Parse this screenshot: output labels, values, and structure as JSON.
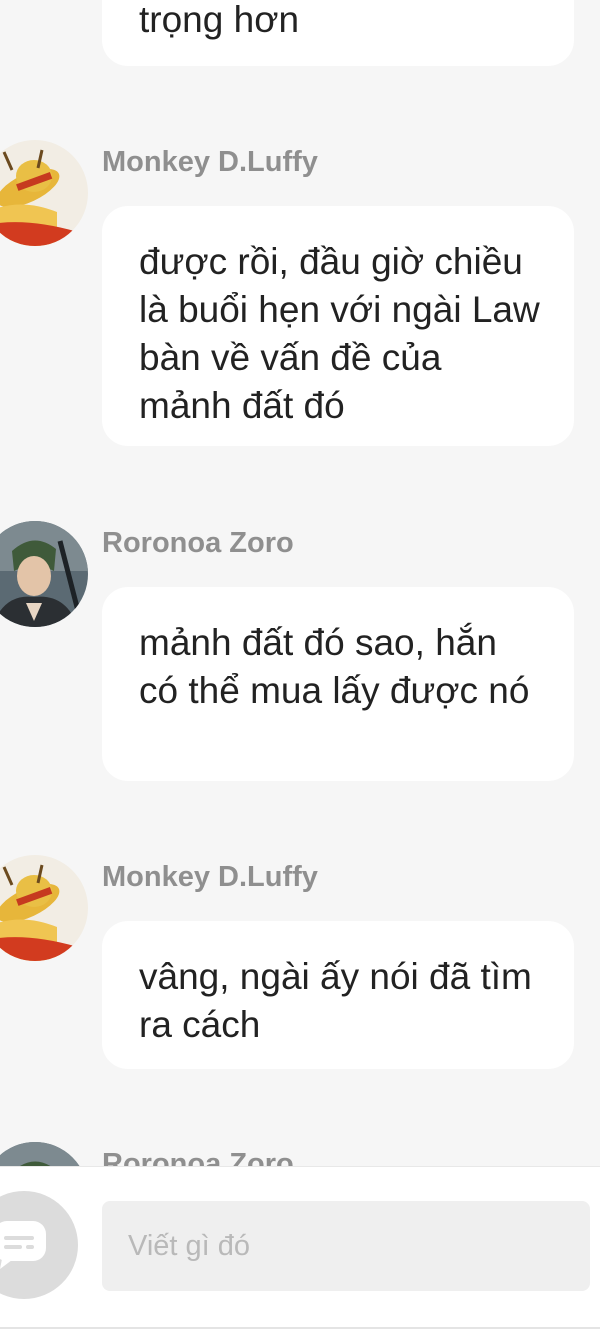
{
  "messages": [
    {
      "sender": "",
      "text": "trọng hơn"
    },
    {
      "sender": "Monkey D.Luffy",
      "text": "được rồi, đầu giờ chiều là buổi hẹn với ngài Law bàn về vấn đề của mảnh đất đó"
    },
    {
      "sender": "Roronoa Zoro",
      "text": "mảnh đất đó sao, hắn có thể mua lấy được nó"
    },
    {
      "sender": "Monkey D.Luffy",
      "text": "vâng, ngài ấy nói đã tìm ra cách"
    },
    {
      "sender": "Roronoa Zoro",
      "text": ""
    }
  ],
  "composer": {
    "placeholder": "Viết gì đó",
    "button_icon": "chat-bubble-icon"
  },
  "colors": {
    "background": "#f6f6f6",
    "bubble": "#ffffff",
    "sender_name": "#8f8f8f",
    "message_text": "#222222",
    "placeholder": "#b9b9b9"
  }
}
